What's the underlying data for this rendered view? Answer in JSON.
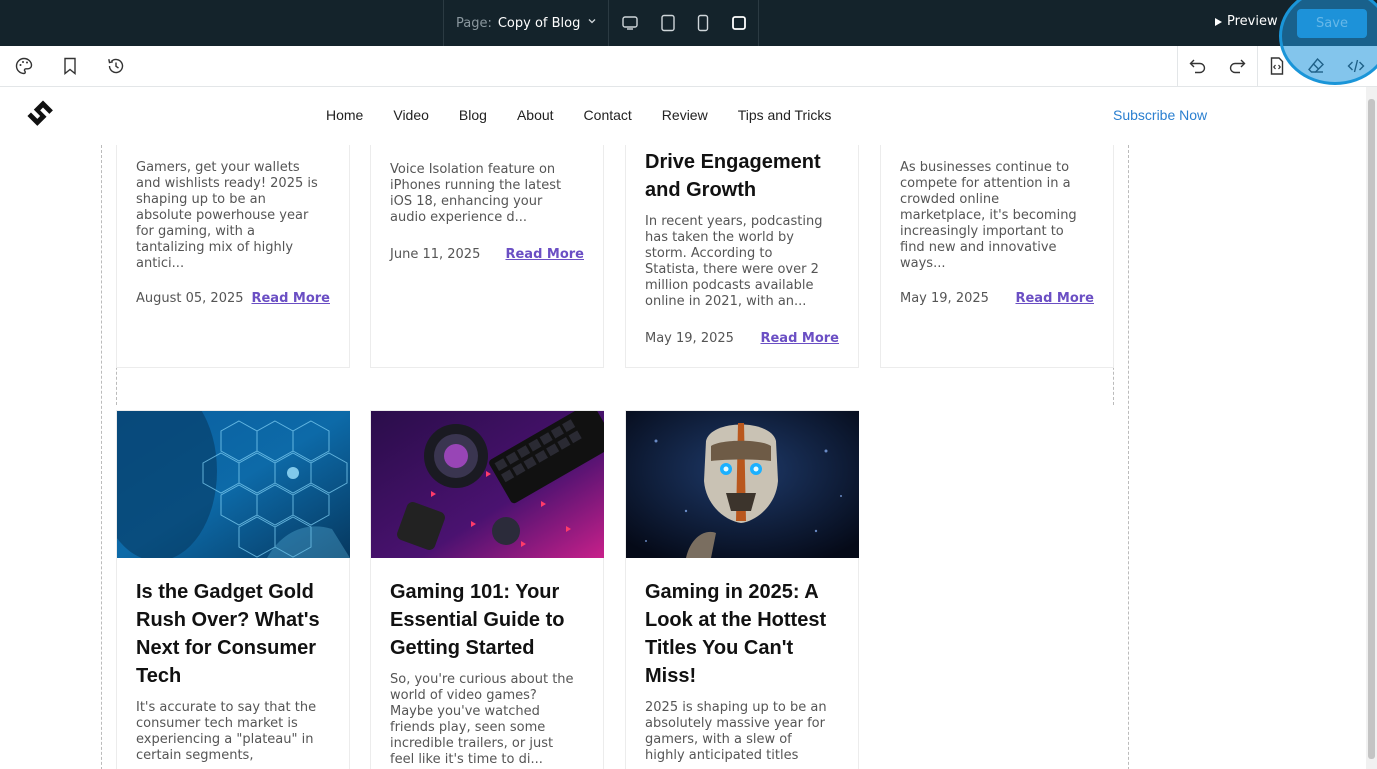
{
  "editor": {
    "page_label": "Page:",
    "page_name": "Copy of Blog",
    "preview_label": "Preview",
    "save_label": "Save"
  },
  "site": {
    "nav": [
      "Home",
      "Video",
      "Blog",
      "About",
      "Contact",
      "Review",
      "Tips and Tricks"
    ],
    "subscribe": "Subscribe Now"
  },
  "row1": [
    {
      "excerpt_lines": [
        "Gamers, get your wallets",
        "and wishlists ready! 2025 is",
        "shaping up to be an",
        "absolute powerhouse year",
        "for gaming, with a",
        "tantalizing mix of highly",
        "antici..."
      ],
      "date": "August 05, 2025",
      "read_more": "Read More"
    },
    {
      "excerpt_lines": [
        "Voice Isolation feature on",
        "iPhones running the latest",
        "iOS 18, enhancing your",
        "audio experience d..."
      ],
      "date": "June 11, 2025",
      "read_more": "Read More"
    },
    {
      "title_lines": [
        "Drive Engagement",
        "and Growth"
      ],
      "excerpt_lines": [
        "In recent years, podcasting",
        "has taken the world by",
        "storm. According to",
        "Statista, there were over 2",
        "million podcasts available",
        "online in 2021, with an..."
      ],
      "date": "May 19, 2025",
      "read_more": "Read More"
    },
    {
      "excerpt_lines": [
        "As businesses continue to",
        "compete for attention in a",
        "crowded online",
        "marketplace, it's becoming",
        "increasingly important to",
        "find new and innovative",
        "ways..."
      ],
      "date": "May 19, 2025",
      "read_more": "Read More"
    }
  ],
  "row2": [
    {
      "title_lines": [
        "Is the Gadget Gold",
        "Rush Over? What's",
        "Next for Consumer",
        "Tech"
      ],
      "excerpt_lines": [
        "It's accurate to say that the",
        "consumer tech market is",
        "experiencing a \"plateau\" in",
        "certain segments,"
      ]
    },
    {
      "title_lines": [
        "Gaming 101: Your",
        "Essential Guide to",
        "Getting Started"
      ],
      "excerpt_lines": [
        "So, you're curious about the",
        "world of video games?",
        "Maybe you've watched",
        "friends play, seen some",
        "incredible trailers, or just",
        "feel like it's time to di..."
      ]
    },
    {
      "title_lines": [
        "Gaming in 2025: A",
        "Look at the Hottest",
        "Titles You Can't",
        "Miss!"
      ],
      "excerpt_lines": [
        "2025 is shaping up to be an",
        "absolutely massive year for",
        "gamers, with a slew of",
        "highly anticipated titles"
      ]
    }
  ]
}
